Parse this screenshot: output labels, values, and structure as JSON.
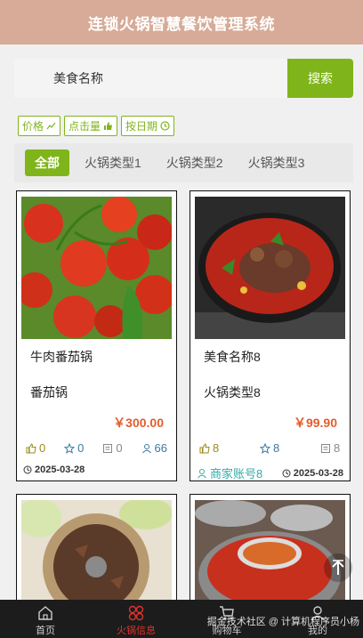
{
  "header": {
    "title": "连锁火锅智慧餐饮管理系统"
  },
  "search": {
    "value": "美食名称",
    "button": "搜索"
  },
  "sort": {
    "price": "价格",
    "clicks": "点击量",
    "date": "按日期"
  },
  "tabs": [
    "全部",
    "火锅类型1",
    "火锅类型2",
    "火锅类型3"
  ],
  "cards": [
    {
      "title": "牛肉番茄锅",
      "type": "番茄锅",
      "price": "￥300.00",
      "likes": "0",
      "favorites": "0",
      "comments": "0",
      "views": "66",
      "date": "2025-03-28",
      "merchant": ""
    },
    {
      "title": "美食名称8",
      "type": "火锅类型8",
      "price": "￥99.90",
      "likes": "8",
      "favorites": "8",
      "comments": "8",
      "views": "",
      "date": "2025-03-28",
      "merchant": "商家账号8"
    }
  ],
  "tabbar": [
    "首页",
    "火锅信息",
    "购物车",
    "我的"
  ],
  "watermark": "掘金技术社区 @ 计算机程序员小杨",
  "colors": {
    "accent": "#7fb51b",
    "header": "#d7ab98",
    "price": "#e45c2c",
    "active_tab": "#e0322c"
  }
}
